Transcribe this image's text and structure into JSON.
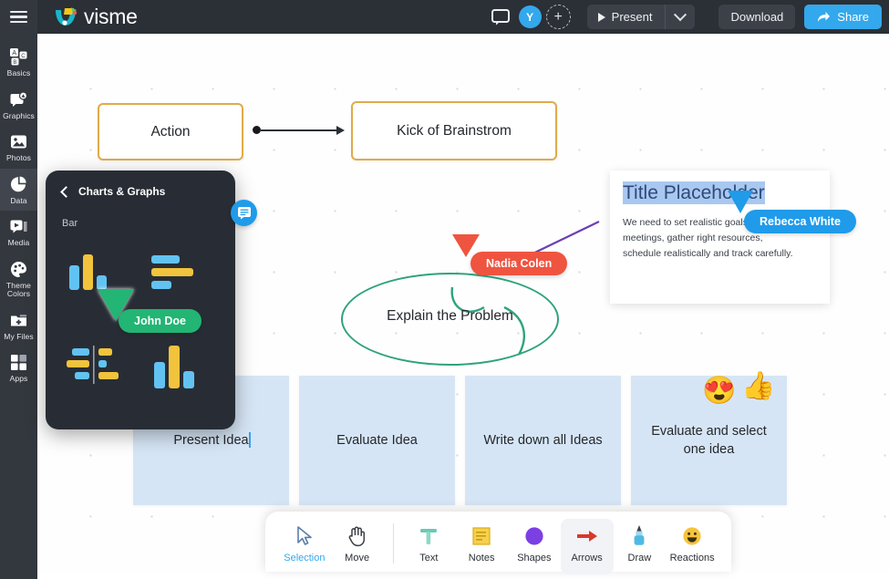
{
  "header": {
    "menu_icon": "hamburger-icon",
    "brand": "visme",
    "chat_icon": "chat-icon",
    "avatar_initial": "Y",
    "add_user_icon": "add-user-icon",
    "present_label": "Present",
    "present_caret_icon": "chevron-down-icon",
    "download_label": "Download",
    "share_label": "Share",
    "share_icon": "share-arrow-icon",
    "colors": {
      "bar_bg": "#2b2f36",
      "accent_blue": "#33a8ec",
      "button_bg": "#3c4149"
    }
  },
  "sidebar": {
    "items": [
      {
        "label": "Basics",
        "icon": "blocks-icon",
        "active": false
      },
      {
        "label": "Graphics",
        "icon": "graphics-icon",
        "active": false
      },
      {
        "label": "Photos",
        "icon": "photo-icon",
        "active": false
      },
      {
        "label": "Data",
        "icon": "pie-chart-icon",
        "active": true
      },
      {
        "label": "Media",
        "icon": "media-icon",
        "active": false
      },
      {
        "label": "Theme\nColors",
        "icon": "palette-icon",
        "active": false
      },
      {
        "label": "My Files",
        "icon": "folder-plus-icon",
        "active": false
      },
      {
        "label": "Apps",
        "icon": "grid-apps-icon",
        "active": false
      }
    ]
  },
  "charts_panel": {
    "back_icon": "chevron-left-icon",
    "title": "Charts & Graphs",
    "section_label": "Bar",
    "thumbnails": [
      "vertical-bar-chart-thumb",
      "horizontal-bar-chart-thumb",
      "diverging-bar-chart-thumb",
      "column-chart-thumb"
    ]
  },
  "note_badge": {
    "icon": "comment-note-icon"
  },
  "canvas": {
    "nodes": [
      {
        "id": "action",
        "label": "Action"
      },
      {
        "id": "kickoff",
        "label": "Kick of Brainstrom"
      }
    ],
    "ellipse": {
      "label": "Explain the Problem",
      "color": "#2fa37c"
    },
    "title_card": {
      "title": "Title Placeholder",
      "body": "We need to set realistic goals, hold meetings, gather right resources, schedule realistically and track carefully."
    },
    "sticky_notes": [
      {
        "text": "Present Idea",
        "editing": true
      },
      {
        "text": "Evaluate Idea",
        "editing": false
      },
      {
        "text": "Write down all Ideas",
        "editing": false
      },
      {
        "text": "Evaluate and select one idea",
        "editing": false
      }
    ],
    "cursors": [
      {
        "name": "John Doe",
        "color": "#22b573"
      },
      {
        "name": "Nadia Colen",
        "color": "#ef5440"
      },
      {
        "name": "Rebecca White",
        "color": "#1f9bea"
      }
    ],
    "reactions": [
      {
        "icon": "heart-eyes-emoji",
        "glyph": "😍"
      },
      {
        "icon": "thumbs-up-emoji",
        "glyph": "👍"
      }
    ]
  },
  "toolbar": {
    "tools": [
      {
        "label": "Selection",
        "icon": "cursor-arrow-icon",
        "state": "active"
      },
      {
        "label": "Move",
        "icon": "hand-icon",
        "state": "normal"
      },
      {
        "label": "Text",
        "icon": "text-t-icon",
        "state": "normal"
      },
      {
        "label": "Notes",
        "icon": "sticky-note-icon",
        "state": "normal"
      },
      {
        "label": "Shapes",
        "icon": "circle-shape-icon",
        "state": "normal"
      },
      {
        "label": "Arrows",
        "icon": "arrow-right-icon",
        "state": "selected"
      },
      {
        "label": "Draw",
        "icon": "pen-icon",
        "state": "normal"
      },
      {
        "label": "Reactions",
        "icon": "smiley-icon",
        "state": "normal"
      }
    ]
  }
}
